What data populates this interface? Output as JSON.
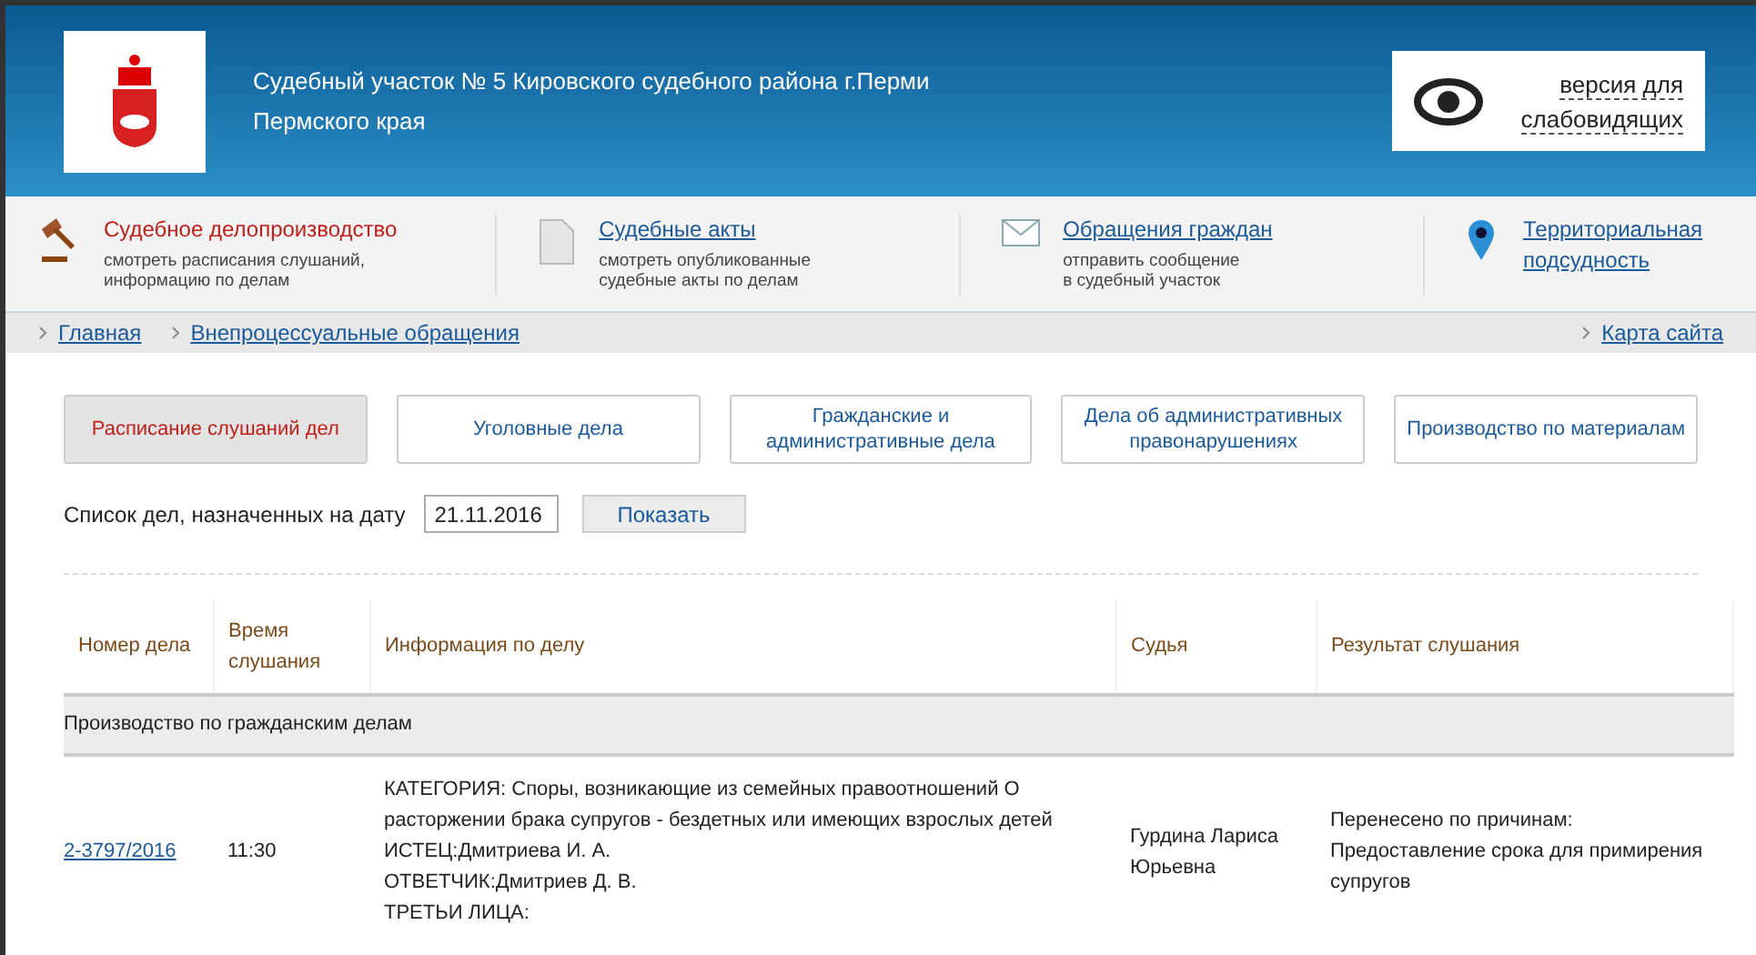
{
  "header": {
    "title_line_1": "Судебный участок № 5 Кировского судебного района г.Перми",
    "title_line_2": "Пермского края",
    "accessibility_button": {
      "line_1": "версия для",
      "line_2": "слабовидящих"
    }
  },
  "nav": [
    {
      "kind": "gavel",
      "title": "Судебное делопроизводство",
      "subtitle": [
        "смотреть расписания слушаний,",
        "информацию по делам"
      ],
      "selected": true
    },
    {
      "kind": "document",
      "title": "Судебные акты",
      "subtitle": [
        "смотреть опубликованные",
        "судебные акты по делам"
      ],
      "selected": false
    },
    {
      "kind": "mail",
      "title": "Обращения граждан",
      "subtitle": [
        "отправить сообщение",
        "в судебный участок"
      ],
      "selected": false
    },
    {
      "kind": "pin",
      "title": "Территориальная подсудность",
      "selected": false
    }
  ],
  "breadcrumbs": [
    "Главная",
    "Внепроцессуальные обращения"
  ],
  "sitemap_link": "Карта сайта",
  "tabs": [
    {
      "label": "Расписание слушаний дел",
      "selected": true
    },
    {
      "label": "Уголовные дела",
      "selected": false
    },
    {
      "label": "Гражданские и административные дела",
      "selected": false
    },
    {
      "label": "Дела об административных правонарушениях",
      "selected": false
    },
    {
      "label": "Производство по материалам",
      "selected": false
    }
  ],
  "date_filter": {
    "label": "Список дел, назначенных на дату",
    "value": "21.11.2016",
    "button": "Показать"
  },
  "table": {
    "columns": [
      "Номер дела",
      "Время слушания",
      "Информация по делу",
      "Судья",
      "Результат слушания"
    ],
    "section": "Производство по гражданским делам",
    "rows": [
      {
        "case_number": "2-3797/2016",
        "time": "11:30",
        "info": [
          "КАТЕГОРИЯ: Споры, возникающие из семейных правоотношений О расторжении брака супругов - бездетных или имеющих взрослых детей",
          "ИСТЕЦ:Дмитриева И. А.",
          "ОТВЕТЧИК:Дмитриев Д. В.",
          "ТРЕТЬИ ЛИЦА:"
        ],
        "judge": "Гурдина Лариса Юрьевна",
        "result": [
          "Перенесено по причинам:",
          "Предоставление срока для примирения супругов"
        ]
      }
    ]
  }
}
